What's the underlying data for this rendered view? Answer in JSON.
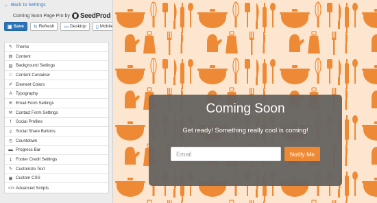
{
  "sidebar": {
    "back_link": "Back to Settings",
    "back_icon": "arrow-left-icon",
    "title": "Coming Soon Page Pro by",
    "logo_text": "SeedProd",
    "toolbar": {
      "save": "Save",
      "refresh": "Refresh",
      "desktop": "Desktop",
      "mobile": "Mobile"
    },
    "menu": [
      {
        "label": "Theme",
        "icon": "brush-icon"
      },
      {
        "label": "Content",
        "icon": "document-icon"
      },
      {
        "label": "Background Settings",
        "icon": "image-icon"
      },
      {
        "label": "Content Container",
        "icon": "square-icon"
      },
      {
        "label": "Element Colors",
        "icon": "paint-icon"
      },
      {
        "label": "Typography",
        "icon": "font-icon"
      },
      {
        "label": "Email Form Settings",
        "icon": "envelope-icon"
      },
      {
        "label": "Contact Form Settings",
        "icon": "envelope-open-icon"
      },
      {
        "label": "Social Profiles",
        "icon": "facebook-icon"
      },
      {
        "label": "Social Share Buttons",
        "icon": "share-icon"
      },
      {
        "label": "Countdown",
        "icon": "clock-icon"
      },
      {
        "label": "Progress Bar",
        "icon": "progress-icon"
      },
      {
        "label": "Footer Credit Settings",
        "icon": "pin-icon"
      },
      {
        "label": "Customize Text",
        "icon": "edit-icon"
      },
      {
        "label": "Custom CSS",
        "icon": "css-icon"
      },
      {
        "label": "Advanced Scripts",
        "icon": "code-icon"
      }
    ]
  },
  "preview": {
    "background_color": "#fde6cf",
    "pattern_color": "#ee8a35",
    "title": "Coming Soon",
    "subtitle": "Get ready! Something really cool is coming!",
    "email_placeholder": "Email",
    "notify_button": "Notify Me"
  },
  "colors": {
    "accent": "#2b73b8",
    "button": "#ee8a35",
    "card": "#686461"
  }
}
